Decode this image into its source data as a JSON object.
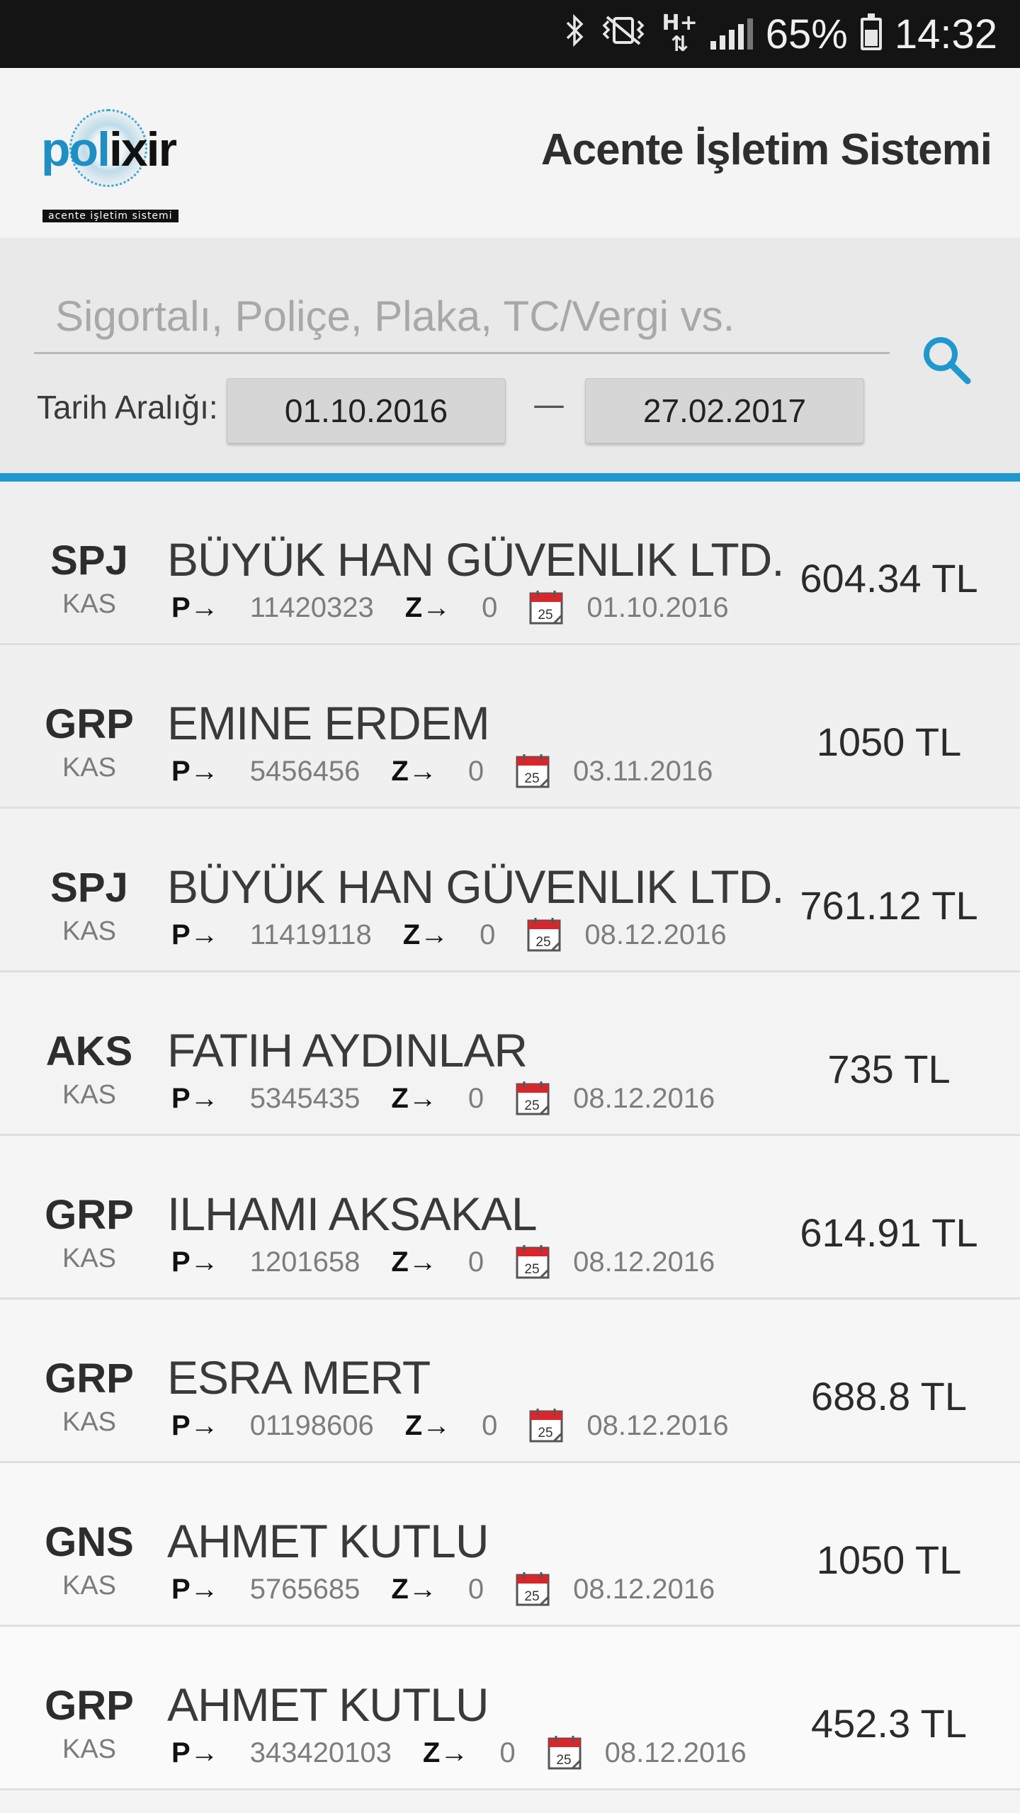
{
  "statusbar": {
    "network_label": "H+",
    "battery": "65%",
    "time": "14:32",
    "icons": [
      "bluetooth-icon",
      "vibrate-icon",
      "network-type-icon",
      "signal-icon",
      "battery-icon"
    ]
  },
  "header": {
    "logo_text_part1": "pol",
    "logo_text_part2": "ixir",
    "logo_tagline": "acente işletim sistemi",
    "title": "Acente İşletim Sistemi"
  },
  "search": {
    "placeholder": "Sigortalı, Poliçe, Plaka, TC/Vergi vs.",
    "value": ""
  },
  "date_range": {
    "label": "Tarih Aralığı:",
    "from": "01.10.2016",
    "separator": "—",
    "to": "27.02.2017"
  },
  "colors": {
    "accent": "#1f98cf",
    "calendar_red": "#d9262c"
  },
  "list_labels": {
    "policy_tag": "P→",
    "z_tag": "Z→",
    "calendar_day": "25"
  },
  "rows": [
    {
      "code": "SPJ",
      "sub": "KAS",
      "name": "BÜYÜK HAN GÜVENLIK LTD.",
      "policy": "11420323",
      "z": "0",
      "date": "01.10.2016",
      "amount": "604.34 TL"
    },
    {
      "code": "GRP",
      "sub": "KAS",
      "name": "EMINE ERDEM",
      "policy": "5456456",
      "z": "0",
      "date": "03.11.2016",
      "amount": "1050 TL"
    },
    {
      "code": "SPJ",
      "sub": "KAS",
      "name": "BÜYÜK HAN GÜVENLIK LTD.",
      "policy": "11419118",
      "z": "0",
      "date": "08.12.2016",
      "amount": "761.12 TL"
    },
    {
      "code": "AKS",
      "sub": "KAS",
      "name": "FATIH AYDINLAR",
      "policy": "5345435",
      "z": "0",
      "date": "08.12.2016",
      "amount": "735 TL"
    },
    {
      "code": "GRP",
      "sub": "KAS",
      "name": "ILHAMI AKSAKAL",
      "policy": "1201658",
      "z": "0",
      "date": "08.12.2016",
      "amount": "614.91 TL"
    },
    {
      "code": "GRP",
      "sub": "KAS",
      "name": "ESRA MERT",
      "policy": "01198606",
      "z": "0",
      "date": "08.12.2016",
      "amount": "688.8 TL"
    },
    {
      "code": "GNS",
      "sub": "KAS",
      "name": "AHMET KUTLU",
      "policy": "5765685",
      "z": "0",
      "date": "08.12.2016",
      "amount": "1050 TL"
    },
    {
      "code": "GRP",
      "sub": "KAS",
      "name": "AHMET KUTLU",
      "policy": "343420103",
      "z": "0",
      "date": "08.12.2016",
      "amount": "452.3 TL"
    }
  ]
}
